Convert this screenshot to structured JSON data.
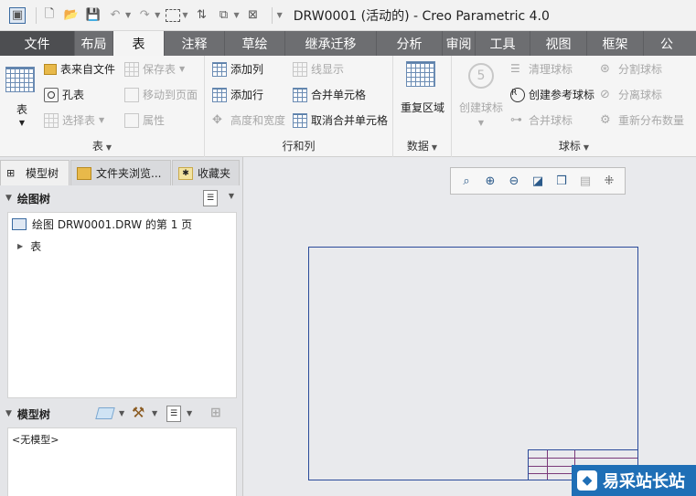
{
  "window": {
    "title": "DRW0001 (活动的) - Creo Parametric 4.0"
  },
  "ribbon_tabs": [
    {
      "label": "文件"
    },
    {
      "label": "布局"
    },
    {
      "label": "表"
    },
    {
      "label": "注释"
    },
    {
      "label": "草绘"
    },
    {
      "label": "继承迁移"
    },
    {
      "label": "分析"
    },
    {
      "label": "审阅"
    },
    {
      "label": "工具"
    },
    {
      "label": "视图"
    },
    {
      "label": "框架"
    },
    {
      "label": "公"
    }
  ],
  "ribbon": {
    "table_group": {
      "label": "表",
      "table_button": "表",
      "table_from_file": "表来自文件",
      "hole_table": "孔表",
      "select_table": "选择表",
      "save_table": "保存表",
      "move_to_page": "移动到页面",
      "properties": "属性"
    },
    "rows_cols_group": {
      "label": "行和列",
      "add_column": "添加列",
      "add_row": "添加行",
      "height_width": "高度和宽度",
      "line_display": "线显示",
      "merge_cells": "合并单元格",
      "unmerge_cells": "取消合并单元格"
    },
    "data_group": {
      "label": "数据",
      "repeat_region": "重复区域"
    },
    "balloon_group": {
      "label": "球标",
      "create_balloon": "创建球标",
      "clean_balloons": "清理球标",
      "create_ref_balloon": "创建参考球标",
      "merge_balloons": "合并球标",
      "split_balloon": "分割球标",
      "detach_balloon": "分离球标",
      "redistribute_qty": "重新分布数量"
    }
  },
  "left_panel": {
    "tabs": [
      {
        "label": "模型树"
      },
      {
        "label": "文件夹浏览..."
      },
      {
        "label": "收藏夹"
      }
    ],
    "drawing_tree": {
      "title": "绘图树",
      "items": [
        {
          "label": "绘图 DRW0001.DRW 的第 1 页"
        },
        {
          "label": "表"
        }
      ]
    },
    "model_tree": {
      "title": "模型树",
      "empty_text": "<无模型>"
    }
  },
  "watermark": {
    "text": "易采站长站"
  },
  "colors": {
    "tab_bar": "#6d6e71",
    "active_tab": "#f4f4f4",
    "sheet_border": "#2a4a9a"
  }
}
